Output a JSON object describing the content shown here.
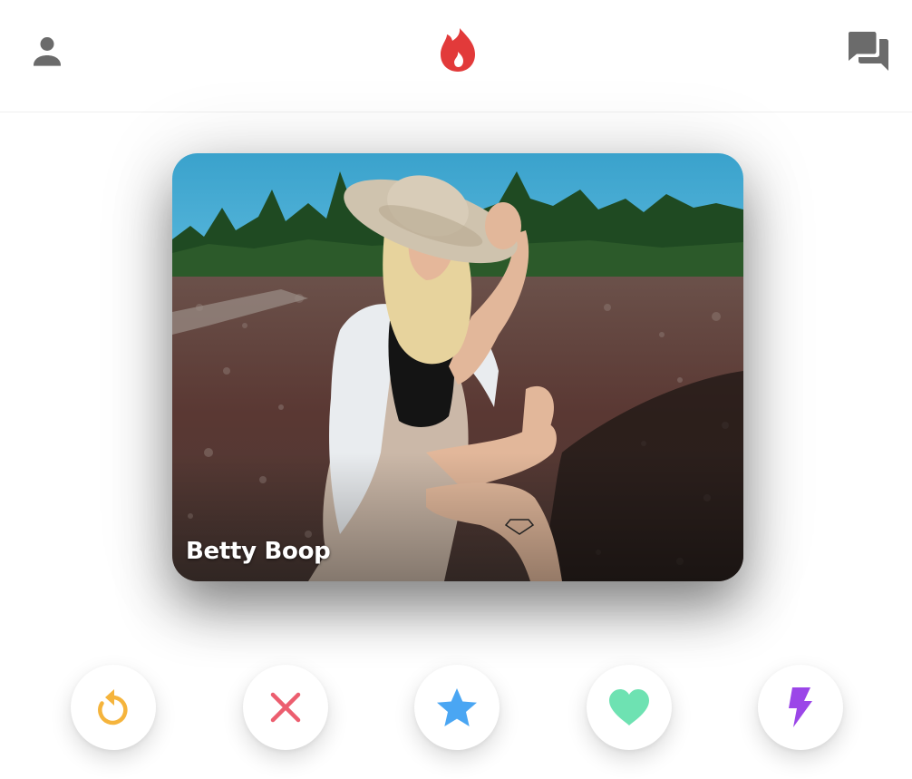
{
  "header": {
    "profile_icon": "person-icon",
    "logo_icon": "flame-icon",
    "messages_icon": "chat-bubbles-icon",
    "colors": {
      "icon_gray": "#6b6b6b",
      "brand_red": "#e23a3a"
    }
  },
  "card": {
    "name": "Betty Boop",
    "photo_icon": "profile-photo"
  },
  "actions": [
    {
      "id": "rewind",
      "icon": "rewind-icon",
      "color": "#f5b43c"
    },
    {
      "id": "nope",
      "icon": "close-icon",
      "color": "#ec5e6f"
    },
    {
      "id": "superlike",
      "icon": "star-icon",
      "color": "#4aa6f3"
    },
    {
      "id": "like",
      "icon": "heart-icon",
      "color": "#6ee2b2"
    },
    {
      "id": "boost",
      "icon": "lightning-icon",
      "color": "#9b46e8"
    }
  ]
}
